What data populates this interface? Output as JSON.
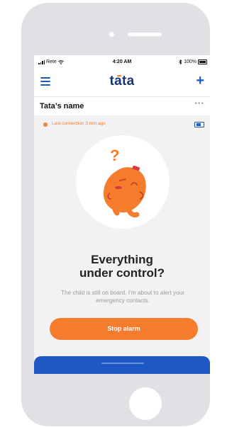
{
  "status_bar": {
    "carrier": "Rete",
    "time": "4:20 AM",
    "battery": "100%"
  },
  "nav": {
    "logo": "tata",
    "menu_icon": "hamburger-menu-icon",
    "add_icon": "plus-icon"
  },
  "profile": {
    "name": "Tata’s name",
    "more_label": "•••"
  },
  "connection": {
    "text": "Last connection 3 min ago"
  },
  "alert": {
    "title_line1": "Everything",
    "title_line2": "under control?",
    "message": "The child is still on board. I’m about to alert your emergency contacts.",
    "question_mark": "?"
  },
  "actions": {
    "stop_label": "Stop alarm"
  },
  "colors": {
    "accent": "#f47c2c",
    "primary": "#1e58c4",
    "brand_text": "#17356e"
  }
}
